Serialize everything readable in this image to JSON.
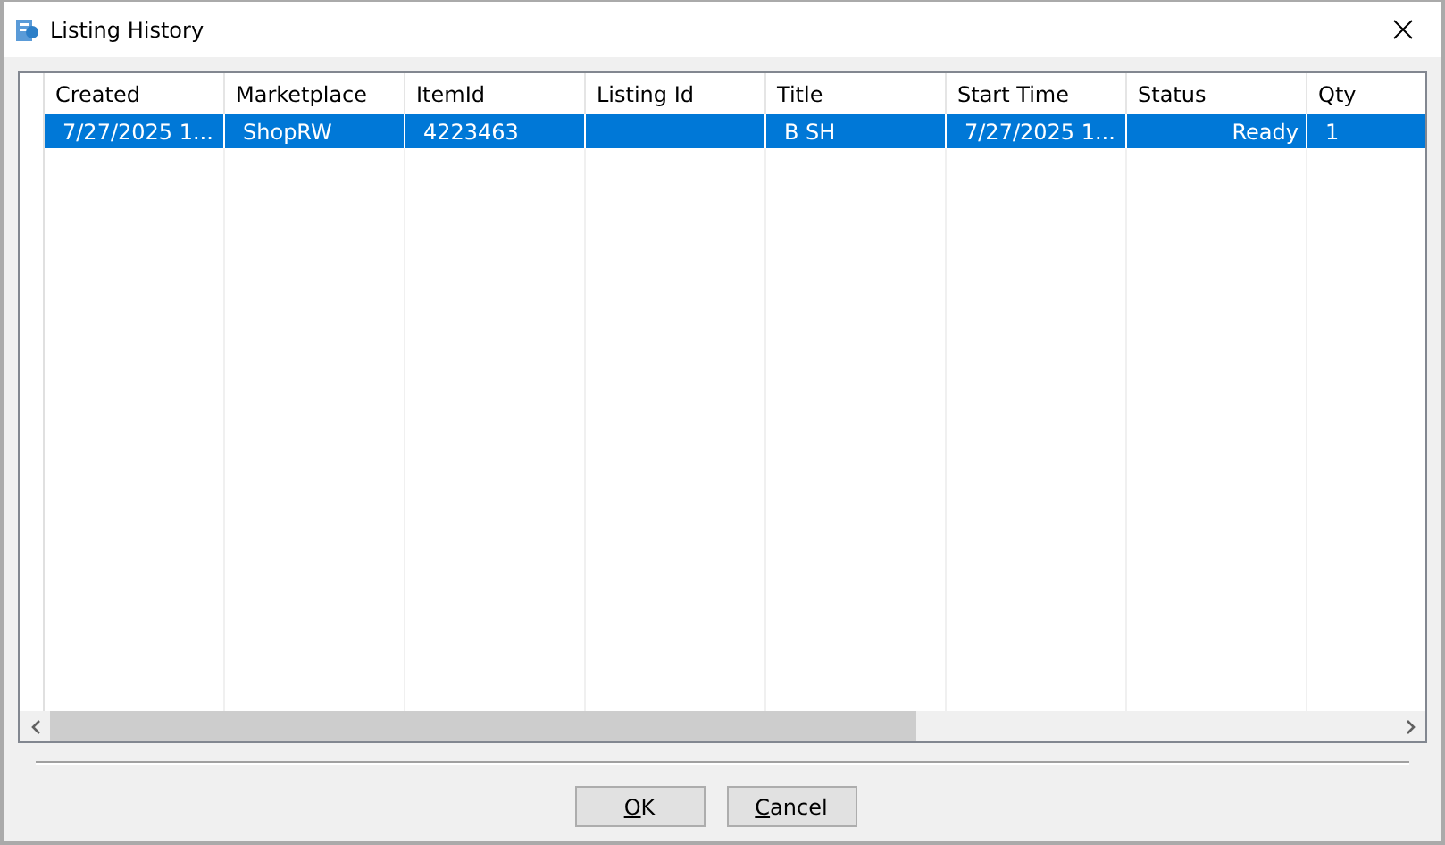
{
  "window": {
    "title": "Listing History"
  },
  "table": {
    "columns": [
      {
        "label": "Created",
        "kind": "text"
      },
      {
        "label": "Marketplace",
        "kind": "text"
      },
      {
        "label": "ItemId",
        "kind": "text"
      },
      {
        "label": "Listing Id",
        "kind": "text"
      },
      {
        "label": "Title",
        "kind": "text"
      },
      {
        "label": "Start Time",
        "kind": "text"
      },
      {
        "label": "Status",
        "kind": "status"
      },
      {
        "label": "Qty",
        "kind": "text"
      }
    ],
    "rows": [
      {
        "selected": true,
        "cells": [
          "7/27/2025 1...",
          "ShopRW",
          "4223463",
          "",
          "B SH",
          "7/27/2025 1...",
          "Ready",
          "1"
        ]
      }
    ]
  },
  "buttons": [
    "OK",
    "Cancel"
  ]
}
